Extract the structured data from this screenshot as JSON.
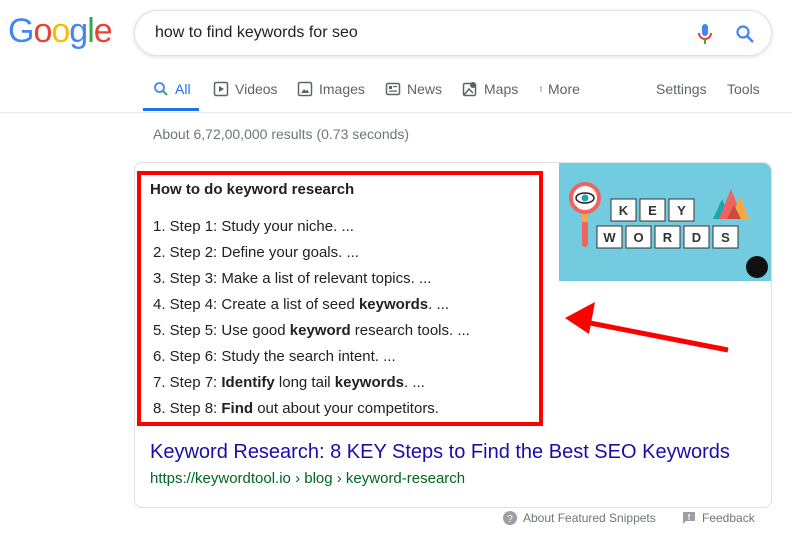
{
  "logo": "Google",
  "search": {
    "query": "how to find keywords for seo",
    "mic_icon": "mic-icon",
    "search_icon": "search-icon"
  },
  "tabs": [
    {
      "label": "All",
      "icon": "search-icon",
      "active": true
    },
    {
      "label": "Videos",
      "icon": "video-icon"
    },
    {
      "label": "Images",
      "icon": "image-icon"
    },
    {
      "label": "News",
      "icon": "news-icon"
    },
    {
      "label": "Maps",
      "icon": "map-icon"
    },
    {
      "label": "More",
      "icon": "more-icon"
    }
  ],
  "settings": "Settings",
  "tools": "Tools",
  "stats": "About 6,72,00,000 results (0.73 seconds)",
  "snippet": {
    "title": "How to do keyword research",
    "steps": [
      [
        "1. Step 1: Study your niche. ..."
      ],
      [
        "2. Step 2: Define your goals. ..."
      ],
      [
        "3. Step 3: Make a list of relevant topics. ..."
      ],
      [
        "4. Step 4: Create a list of seed ",
        "keywords",
        ". ..."
      ],
      [
        "5. Step 5: Use good ",
        "keyword",
        " research tools. ..."
      ],
      [
        "6. Step 6: Study the search intent. ..."
      ],
      [
        "7. Step 7: ",
        "Identify",
        " long tail ",
        "keywords",
        ". ..."
      ],
      [
        "8. Step 8: ",
        "Find",
        " out about your competitors."
      ]
    ],
    "image_letters": [
      "K",
      "E",
      "Y",
      "W",
      "O",
      "R",
      "D",
      "S"
    ],
    "result_title": "Keyword Research: 8 KEY Steps to Find the Best SEO Keywords",
    "result_url": "https://keywordtool.io › blog › keyword-research"
  },
  "footer": {
    "about": "About Featured Snippets",
    "feedback": "Feedback"
  },
  "colors": {
    "highlight": "#ff0000",
    "link": "#1a0dab",
    "url": "#006621",
    "accent": "#1a73e8"
  }
}
